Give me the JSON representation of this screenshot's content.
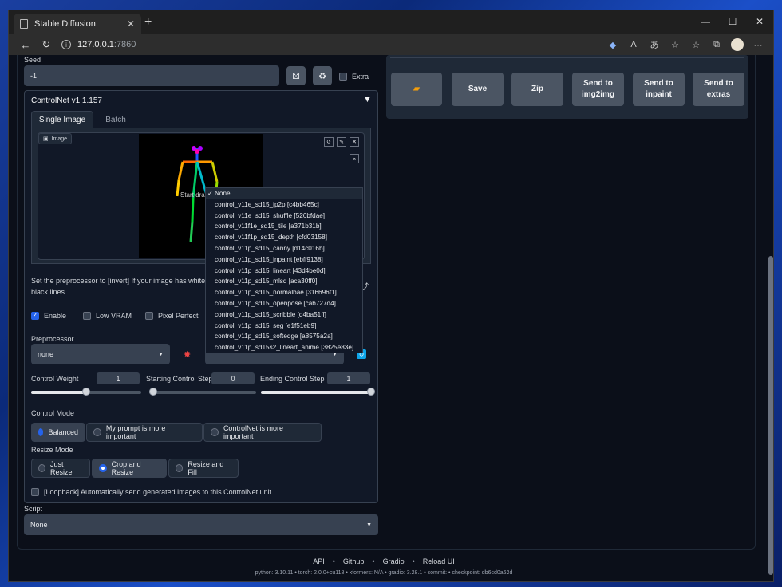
{
  "browser": {
    "tab_title": "Stable Diffusion",
    "url_host": "127.0.0.1",
    "url_port": ":7860"
  },
  "seed": {
    "label": "Seed",
    "value": "-1",
    "extra_label": "Extra"
  },
  "controlnet": {
    "title": "ControlNet v1.1.157",
    "tabs": [
      "Single Image",
      "Batch"
    ],
    "image_label": "Image",
    "drop_hint": "Start dra",
    "hint_text_1": "Set the preprocessor to [invert] If your image has white ba",
    "hint_text_2": "black lines.",
    "enable_label": "Enable",
    "lowvram_label": "Low VRAM",
    "pixelperfect_label": "Pixel Perfect",
    "preprocessor_label": "Preprocessor",
    "preprocessor_value": "none",
    "weight_label": "Control Weight",
    "weight_value": "1",
    "weight_fraction": 0.5,
    "start_label": "Starting Control Step",
    "start_value": "0",
    "start_fraction": 0,
    "end_label": "Ending Control Step",
    "end_value": "1",
    "end_fraction": 1,
    "mode_label": "Control Mode",
    "modes": [
      "Balanced",
      "My prompt is more important",
      "ControlNet is more important"
    ],
    "resize_label": "Resize Mode",
    "resizes": [
      "Just Resize",
      "Crop and Resize",
      "Resize and Fill"
    ],
    "loopback_label": "[Loopback] Automatically send generated images to this ControlNet unit"
  },
  "model_dropdown": {
    "options": [
      "None",
      "control_v11e_sd15_ip2p [c4bb465c]",
      "control_v11e_sd15_shuffle [526bfdae]",
      "control_v11f1e_sd15_tile [a371b31b]",
      "control_v11f1p_sd15_depth [cfd03158]",
      "control_v11p_sd15_canny [d14c016b]",
      "control_v11p_sd15_inpaint [ebff9138]",
      "control_v11p_sd15_lineart [43d4be0d]",
      "control_v11p_sd15_mlsd [aca30ff0]",
      "control_v11p_sd15_normalbae [316696f1]",
      "control_v11p_sd15_openpose [cab727d4]",
      "control_v11p_sd15_scribble [d4ba51ff]",
      "control_v11p_sd15_seg [e1f51eb9]",
      "control_v11p_sd15_softedge [a8575a2a]",
      "control_v11p_sd15s2_lineart_anime [3825e83e]"
    ]
  },
  "script": {
    "label": "Script",
    "value": "None"
  },
  "actions": {
    "save": "Save",
    "zip": "Zip",
    "img2img": "Send to img2img",
    "inpaint": "Send to inpaint",
    "extras": "Send to extras"
  },
  "footer": {
    "links": [
      "API",
      "Github",
      "Gradio",
      "Reload UI"
    ],
    "versions": "python: 3.10.11  •  torch: 2.0.0+cu118  •  xformers: N/A  •  gradio: 3.28.1  •  commit:  •  checkpoint: db6cd0a62d"
  },
  "colors": {
    "accent": "#2563eb",
    "page_bg": "#0b0f19",
    "panel_bg": "#1f2937",
    "input_bg": "#374151"
  }
}
